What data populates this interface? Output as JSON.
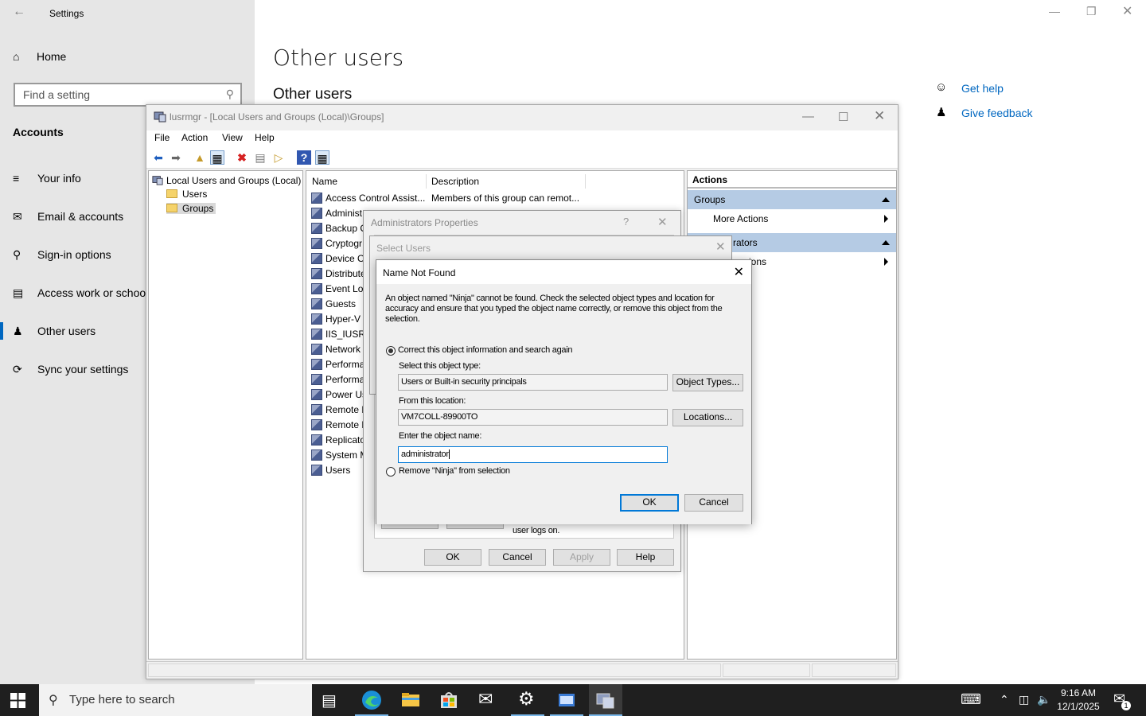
{
  "settings": {
    "title": "Settings",
    "home": "Home",
    "search_placeholder": "Find a setting",
    "section": "Accounts",
    "nav": [
      "Your info",
      "Email & accounts",
      "Sign-in options",
      "Access work or school",
      "Other users",
      "Sync your settings"
    ],
    "page_title": "Other users",
    "page_subtitle": "Other users",
    "get_help": "Get help",
    "give_feedback": "Give feedback",
    "accent": "#0067c0"
  },
  "lusrmgr": {
    "title": "lusrmgr - [Local Users and Groups (Local)\\Groups]",
    "menu": [
      "File",
      "Action",
      "View",
      "Help"
    ],
    "tree_root": "Local Users and Groups (Local)",
    "tree_users": "Users",
    "tree_groups": "Groups",
    "col_name": "Name",
    "col_description": "Description",
    "rows": [
      {
        "name": "Access Control Assist...",
        "desc": "Members of this group can remot..."
      },
      {
        "name": "Administ",
        "desc": ""
      },
      {
        "name": "Backup O",
        "desc": ""
      },
      {
        "name": "Cryptogr",
        "desc": ""
      },
      {
        "name": "Device O",
        "desc": ""
      },
      {
        "name": "Distribute",
        "desc": ""
      },
      {
        "name": "Event Log",
        "desc": ""
      },
      {
        "name": "Guests",
        "desc": ""
      },
      {
        "name": "Hyper-V",
        "desc": ""
      },
      {
        "name": "IIS_IUSRS",
        "desc": ""
      },
      {
        "name": "Network",
        "desc": ""
      },
      {
        "name": "Performa",
        "desc": ""
      },
      {
        "name": "Performa",
        "desc": ""
      },
      {
        "name": "Power Us",
        "desc": ""
      },
      {
        "name": "Remote D",
        "desc": ""
      },
      {
        "name": "Remote M",
        "desc": ""
      },
      {
        "name": "Replicato",
        "desc": ""
      },
      {
        "name": "System M",
        "desc": ""
      },
      {
        "name": "Users",
        "desc": ""
      }
    ],
    "actions_header": "Actions",
    "actions_group1": "Groups",
    "actions_more1": "More Actions",
    "actions_group2": "rators",
    "actions_more2": "ions"
  },
  "admin_props": {
    "title": "Administrators Properties",
    "help_glyph": "?",
    "note": "user logs on.",
    "ok": "OK",
    "cancel": "Cancel",
    "apply": "Apply",
    "help": "Help"
  },
  "select_users": {
    "title": "Select Users"
  },
  "name_not_found": {
    "title": "Name Not Found",
    "message": "An object named \"Ninja\" cannot be found. Check the selected object types and location for accuracy and ensure that you typed the object name correctly, or remove this object from the selection.",
    "option_correct": "Correct this object information and search again",
    "object_type_label": "Select this object type:",
    "object_type_value": "Users or Built-in security principals",
    "object_types_button": "Object Types...",
    "location_label": "From this location:",
    "location_value": "VM7COLL-89900TO",
    "locations_button": "Locations...",
    "object_name_label": "Enter the object name:",
    "object_name_value": "administrator",
    "option_remove": "Remove \"Ninja\" from selection",
    "ok": "OK",
    "cancel": "Cancel"
  },
  "taskbar": {
    "search_placeholder": "Type here to search",
    "time": "9:16 AM",
    "date": "12/1/2025",
    "notification_count": "1"
  }
}
